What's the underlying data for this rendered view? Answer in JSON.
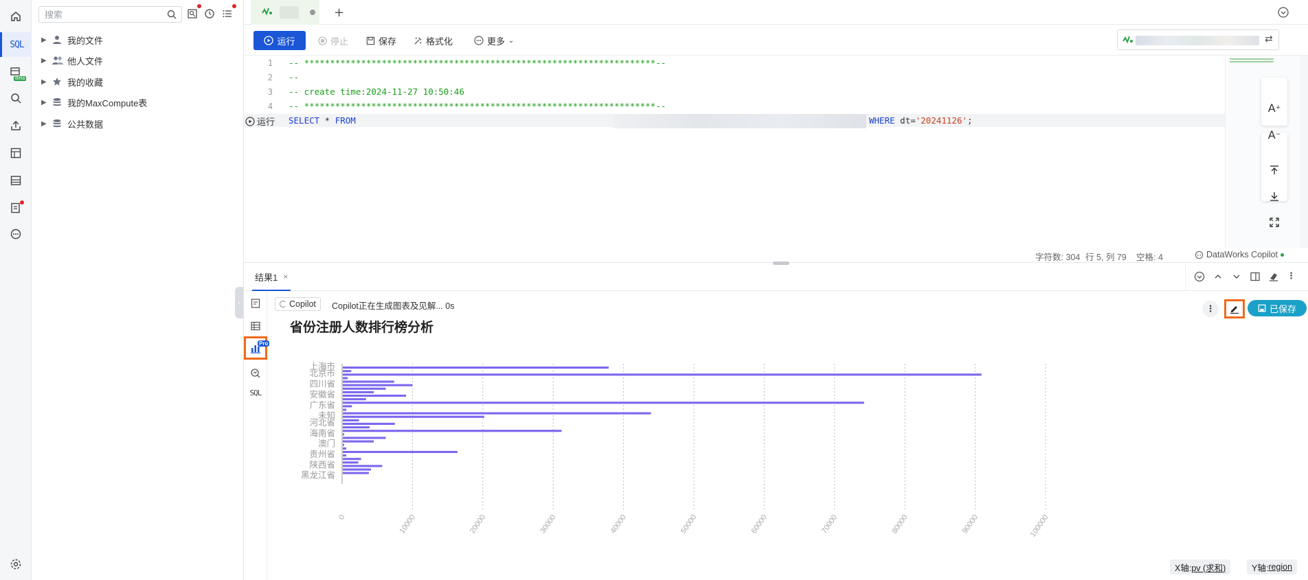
{
  "sidebar": {
    "sql_label": "SQL",
    "beta_label": "Beta"
  },
  "tree": {
    "search_placeholder": "搜索",
    "items": [
      {
        "label": "我的文件",
        "icon": "user-icon"
      },
      {
        "label": "他人文件",
        "icon": "users-icon"
      },
      {
        "label": "我的收藏",
        "icon": "star-icon"
      },
      {
        "label": "我的MaxCompute表",
        "icon": "database-icon"
      },
      {
        "label": "公共数据",
        "icon": "database-icon"
      }
    ]
  },
  "toolbar": {
    "run": "运行",
    "stop": "停止",
    "save": "保存",
    "format": "格式化",
    "more": "更多"
  },
  "editor": {
    "lines": [
      {
        "no": "1",
        "text": "-- ********************************************************************--"
      },
      {
        "no": "2",
        "text": "--"
      },
      {
        "no": "3",
        "text": "-- create time:2024-11-27 10:50:46"
      },
      {
        "no": "4",
        "text": "-- ********************************************************************--"
      },
      {
        "no": "5",
        "kw1": "SELECT",
        "star": " * ",
        "kw2": "FROM",
        "kw3": "WHERE",
        "rest": " dt=",
        "str": "'20241126'",
        "end": ";"
      }
    ],
    "run_inline": "运行"
  },
  "status": {
    "chars": "字符数: 304",
    "pos": "行 5, 列 79",
    "spaces": "空格: 4",
    "copilot": "DataWorks Copilot"
  },
  "results": {
    "tab_label": "结果1",
    "pro_badge": "Pro",
    "sql_label": "SQL",
    "copilot_btn": "Copilot",
    "copilot_status": "Copilot正在生成图表及见解... 0s",
    "saved_btn": "已保存",
    "x_axis_tag_label": "X轴: ",
    "x_axis_tag_value": "pv (求和)",
    "y_axis_tag_label": "Y轴: ",
    "y_axis_tag_value": "region"
  },
  "chart_data": {
    "type": "bar",
    "orientation": "horizontal",
    "title": "省份注册人数排行榜分析",
    "xlim": [
      0,
      100000
    ],
    "x_ticks": [
      "0",
      "10000",
      "20000",
      "30000",
      "40000",
      "50000",
      "60000",
      "70000",
      "80000",
      "90000",
      "100000"
    ],
    "grid": "vertical-dotted",
    "bar_color": "#7b68ee",
    "categories": [
      "上海市",
      "",
      "北京市",
      "",
      "",
      "四川省",
      "",
      "",
      "安徽省",
      "",
      "",
      "广东省",
      "",
      "",
      "未知",
      "",
      "河北省",
      "",
      "",
      "海南省",
      "",
      "",
      "澳门",
      "",
      "",
      "贵州省",
      "",
      "",
      "陕西省",
      "",
      "",
      "黑龙江省",
      ""
    ],
    "values": [
      37800,
      1200,
      90800,
      700,
      7300,
      9900,
      6100,
      4400,
      9000,
      3300,
      74100,
      1300,
      500,
      43800,
      20100,
      2300,
      7400,
      3800,
      31100,
      200,
      6100,
      4400,
      200,
      500,
      16300,
      500,
      2600,
      2200,
      5600,
      4000,
      3700,
      0,
      0
    ]
  }
}
